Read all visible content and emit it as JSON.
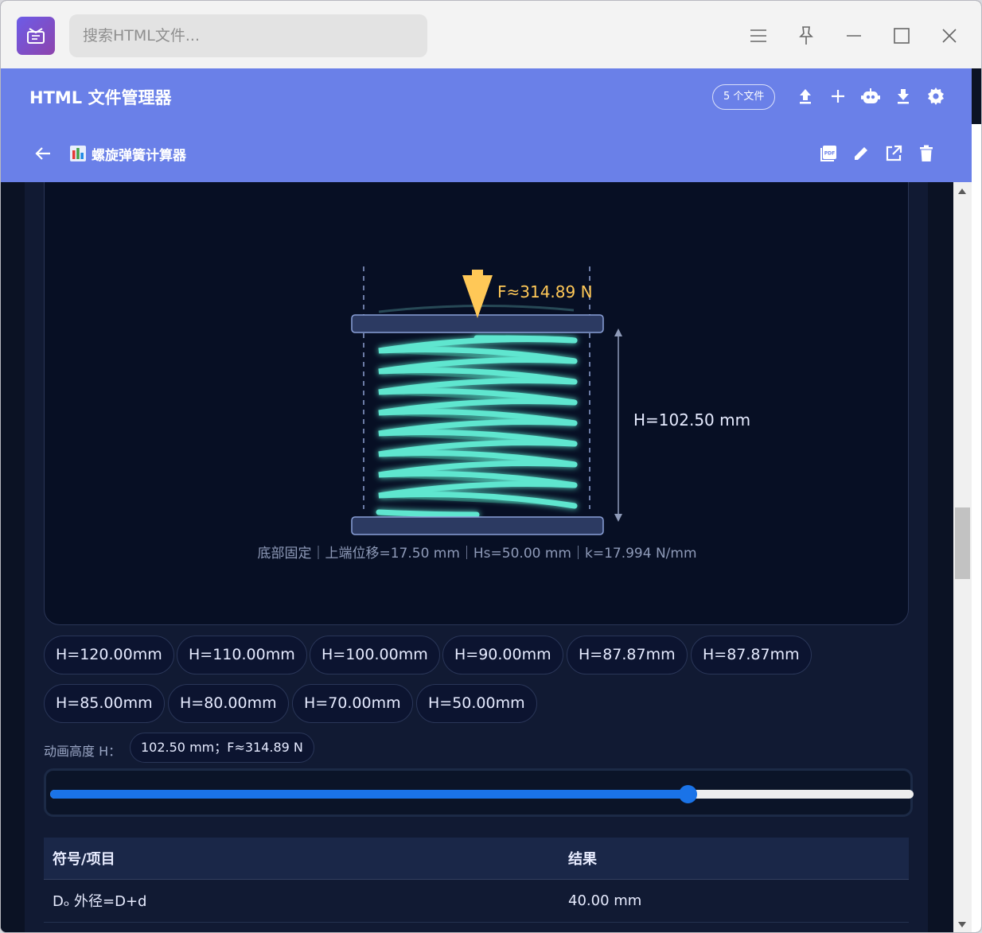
{
  "search": {
    "placeholder": "搜索HTML文件..."
  },
  "header": {
    "title": "HTML 文件管理器",
    "file_count": "5 个文件",
    "current_file": "螺旋弹簧计算器"
  },
  "spring": {
    "force_label": "F≈314.89 N",
    "height_label": "H=102.50 mm",
    "caption": "底部固定｜上端位移=17.50 mm｜Hs=50.00 mm｜k=17.994 N/mm"
  },
  "presets": [
    "H=120.00mm",
    "H=110.00mm",
    "H=100.00mm",
    "H=90.00mm",
    "H=87.87mm",
    "H=87.87mm",
    "H=85.00mm",
    "H=80.00mm",
    "H=70.00mm",
    "H=50.00mm"
  ],
  "animation": {
    "label": "动画高度 H：",
    "value": "102.50 mm；F≈314.89 N",
    "slider_fraction": 0.738
  },
  "table": {
    "headers": [
      "符号/项目",
      "结果"
    ],
    "rows": [
      {
        "item": "Dₒ 外径=D+d",
        "result": "40.00 mm"
      }
    ]
  },
  "colors": {
    "header_bg": "#6a80e8",
    "spring": "#5ee6cf",
    "force": "#ffc857",
    "slider": "#1a73e8"
  }
}
